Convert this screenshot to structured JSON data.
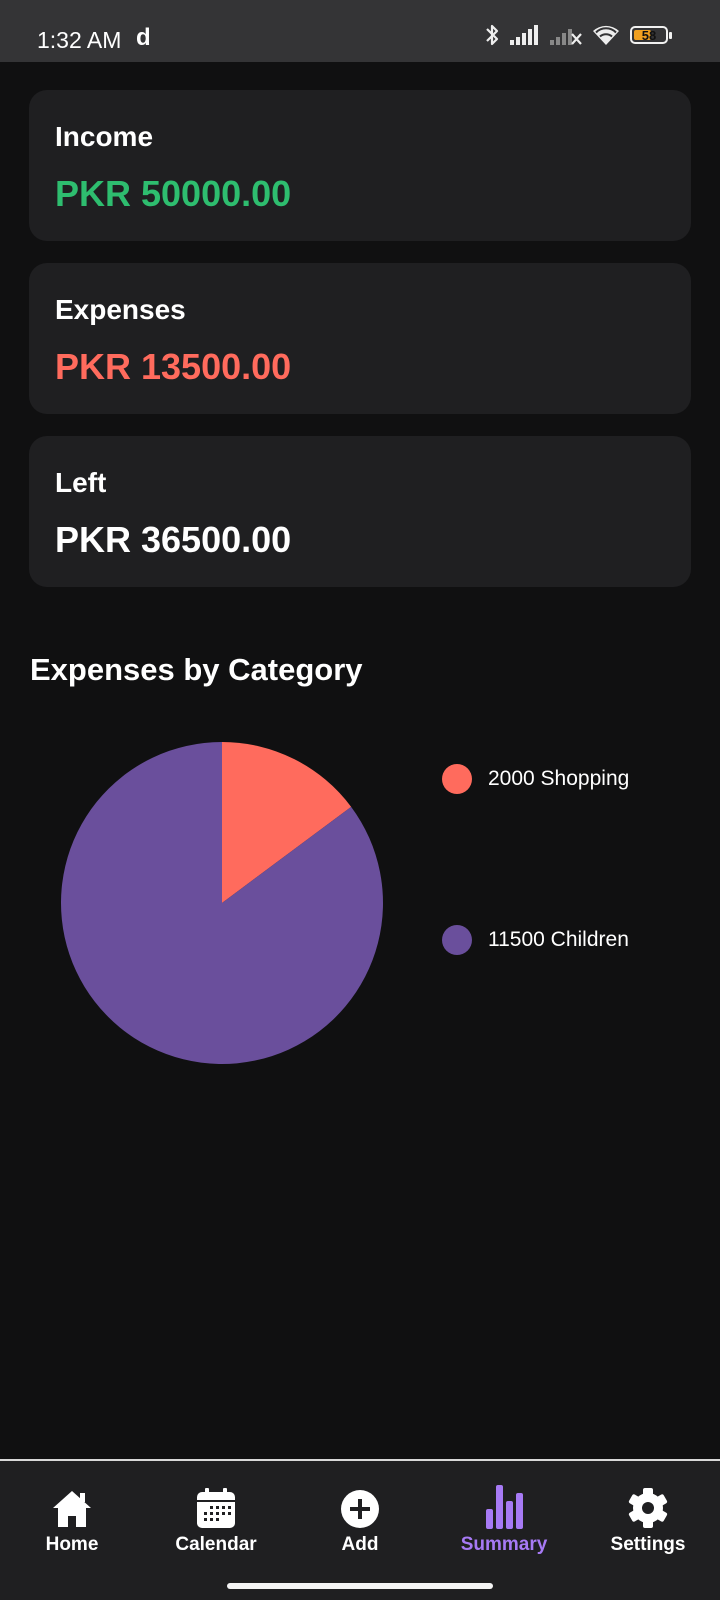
{
  "status_bar": {
    "time": "1:32 AM",
    "app_indicator": "d",
    "battery_level": "58",
    "battery_fraction": 0.58,
    "icons": [
      "bluetooth-icon",
      "signal-icon",
      "signal-no-service-icon",
      "wifi-icon",
      "battery-icon"
    ]
  },
  "cards": {
    "income": {
      "label": "Income",
      "value": "PKR 50000.00",
      "color": "#2ebd6f"
    },
    "expenses": {
      "label": "Expenses",
      "value": "PKR 13500.00",
      "color": "#ff6b5d"
    },
    "left": {
      "label": "Left",
      "value": "PKR 36500.00",
      "color": "#ffffff"
    }
  },
  "section_title": "Expenses by Category",
  "chart_data": {
    "type": "pie",
    "title": "Expenses by Category",
    "slices": [
      {
        "label": "Shopping",
        "value": 2000,
        "color": "#ff6b5d",
        "legend": "2000 Shopping"
      },
      {
        "label": "Children",
        "value": 11500,
        "color": "#6a4f9c",
        "legend": "11500 Children"
      }
    ],
    "legend_placement": "right"
  },
  "bottom_nav": {
    "items": [
      {
        "label": "Home",
        "icon": "home-icon",
        "active": false
      },
      {
        "label": "Calendar",
        "icon": "calendar-icon",
        "active": false
      },
      {
        "label": "Add",
        "icon": "add-circle-icon",
        "active": false
      },
      {
        "label": "Summary",
        "icon": "bar-chart-icon",
        "active": true
      },
      {
        "label": "Settings",
        "icon": "gear-icon",
        "active": false
      }
    ],
    "active_color": "#a77af5"
  }
}
